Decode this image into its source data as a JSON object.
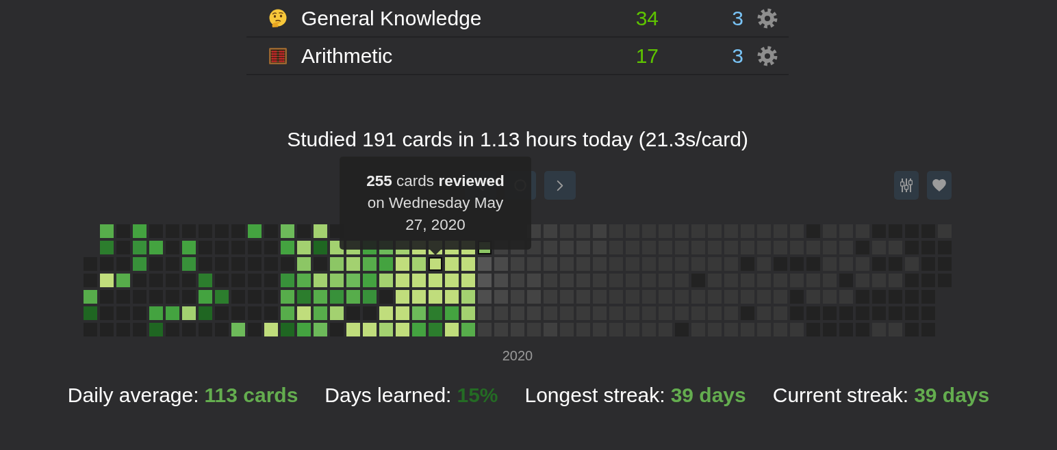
{
  "decks": [
    {
      "kind": "thinking",
      "name": "General Knowledge",
      "column_3": "34",
      "column_4": "3"
    },
    {
      "kind": "abacus",
      "name": "Arithmetic",
      "column_3": "17",
      "column_4": "3"
    }
  ],
  "summary": "Studied 191 cards in 1.13 hours today (21.3s/card)",
  "toolbar": {
    "navigation": [
      {
        "kind": "previous"
      },
      {
        "kind": "today"
      },
      {
        "kind": "next"
      }
    ],
    "tools": [
      {
        "kind": "options"
      },
      {
        "kind": "support"
      }
    ]
  },
  "heatmap": {
    "tooltip": "**255** cards **reviewed** on Wednesday May 27, 2020",
    "year_label": "2020",
    "weeks": [
      {
        "days": [
          {
            "color": "#222222"
          },
          {
            "color": "#222222"
          },
          {
            "color": "#57ad4b"
          },
          {
            "color": "#1f6622"
          },
          {
            "color": "#222222"
          }
        ]
      },
      {
        "days": [
          {
            "color": "#57ad4b"
          },
          {
            "color": "#2c7d2d"
          },
          {
            "color": "#222222"
          },
          {
            "color": "#c0dd7c"
          },
          {
            "color": "#222222"
          },
          {
            "color": "#222222"
          },
          {
            "color": "#222222"
          }
        ]
      },
      {
        "days": [
          {
            "color": "#222222"
          },
          {
            "color": "#222222"
          },
          {
            "color": "#222222"
          },
          {
            "color": "#57ad4b"
          },
          {
            "color": "#222222"
          },
          {
            "color": "#222222"
          },
          {
            "color": "#222222"
          }
        ]
      },
      {
        "days": [
          {
            "color": "#44a340"
          },
          {
            "color": "#38913a"
          },
          {
            "color": "#38913a"
          },
          {
            "color": "#222222"
          },
          {
            "color": "#222222"
          },
          {
            "color": "#222222"
          },
          {
            "color": "#222222"
          }
        ]
      },
      {
        "days": [
          {
            "color": "#222222"
          },
          {
            "color": "#44a340"
          },
          {
            "color": "#222222"
          },
          {
            "color": "#222222"
          },
          {
            "color": "#222222"
          },
          {
            "color": "#44a340"
          },
          {
            "color": "#1f6622"
          }
        ]
      },
      {
        "days": [
          {
            "color": "#222222"
          },
          {
            "color": "#222222"
          },
          {
            "color": "#222222"
          },
          {
            "color": "#222222"
          },
          {
            "color": "#222222"
          },
          {
            "color": "#44a340"
          },
          {
            "color": "#222222"
          }
        ]
      },
      {
        "days": [
          {
            "color": "#222222"
          },
          {
            "color": "#44a340"
          },
          {
            "color": "#38913a"
          },
          {
            "color": "#222222"
          },
          {
            "color": "#222222"
          },
          {
            "color": "#a3d170"
          },
          {
            "color": "#222222"
          }
        ]
      },
      {
        "days": [
          {
            "color": "#222222"
          },
          {
            "color": "#222222"
          },
          {
            "color": "#222222"
          },
          {
            "color": "#2c7d2d"
          },
          {
            "color": "#44a340"
          },
          {
            "color": "#1f6622"
          },
          {
            "color": "#222222"
          }
        ]
      },
      {
        "days": [
          {
            "color": "#222222"
          },
          {
            "color": "#222222"
          },
          {
            "color": "#222222"
          },
          {
            "color": "#222222"
          },
          {
            "color": "#2c7d2d"
          },
          {
            "color": "#222222"
          },
          {
            "color": "#222222"
          }
        ]
      },
      {
        "days": [
          {
            "color": "#222222"
          },
          {
            "color": "#222222"
          },
          {
            "color": "#222222"
          },
          {
            "color": "#222222"
          },
          {
            "color": "#222222"
          },
          {
            "color": "#222222"
          },
          {
            "color": "#6dba5a"
          }
        ]
      },
      {
        "days": [
          {
            "color": "#44a340"
          },
          {
            "color": "#222222"
          },
          {
            "color": "#222222"
          },
          {
            "color": "#222222"
          },
          {
            "color": "#222222"
          },
          {
            "color": "#222222"
          },
          {
            "color": "#222222"
          }
        ]
      },
      {
        "days": [
          {
            "color": "#222222"
          },
          {
            "color": "#222222"
          },
          {
            "color": "#222222"
          },
          {
            "color": "#222222"
          },
          {
            "color": "#222222"
          },
          {
            "color": "#222222"
          },
          {
            "color": "#c0dd7c"
          }
        ]
      },
      {
        "days": [
          {
            "color": "#6dba5a"
          },
          {
            "color": "#44a340"
          },
          {
            "color": "#222222"
          },
          {
            "color": "#38913a"
          },
          {
            "color": "#57ad4b"
          },
          {
            "color": "#57ad4b"
          },
          {
            "color": "#1f6622"
          }
        ]
      },
      {
        "days": [
          {
            "color": "#222222"
          },
          {
            "color": "#a3d170"
          },
          {
            "color": "#8cc665"
          },
          {
            "color": "#57ad4b"
          },
          {
            "color": "#2c7d2d"
          },
          {
            "color": "#c0dd7c"
          },
          {
            "color": "#44a340"
          }
        ]
      },
      {
        "days": [
          {
            "color": "#a3d170"
          },
          {
            "color": "#1f6622"
          },
          {
            "color": "#222222"
          },
          {
            "color": "#a3d170"
          },
          {
            "color": "#57ad4b"
          },
          {
            "color": "#57ad4b"
          },
          {
            "color": "#6dba5a"
          }
        ]
      },
      {
        "days": [
          {
            "color": "#222222"
          },
          {
            "color": "#a3d170"
          },
          {
            "color": "#8cc665"
          },
          {
            "color": "#8cc665"
          },
          {
            "color": "#38913a"
          },
          {
            "color": "#a3d170"
          },
          {
            "color": "#222222"
          }
        ]
      },
      {
        "days": [
          {
            "color": "#a3d170"
          },
          {
            "color": "#a3d170"
          },
          {
            "color": "#6dba5a"
          },
          {
            "color": "#57ad4b"
          },
          {
            "color": "#222222"
          },
          {
            "color": "#c0dd7c"
          }
        ]
      },
      {
        "days": [
          {
            "color": "#44a340"
          },
          {
            "color": "#57ad4b"
          },
          {
            "color": "#44a340"
          },
          {
            "color": "#38913a"
          },
          {
            "color": "#222222"
          },
          {
            "color": "#c0dd7c"
          }
        ]
      },
      {
        "days": [
          {
            "color": "#6dba5a"
          },
          {
            "color": "#44a340"
          },
          {
            "color": "#a3d170"
          },
          {
            "color": "#222222"
          },
          {
            "color": "#c0dd7c"
          },
          {
            "color": "#a3d170"
          }
        ]
      },
      {
        "days": [
          {
            "color": "#a3d170"
          },
          {
            "color": "#c0dd7c"
          },
          {
            "color": "#c0dd7c"
          },
          {
            "color": "#c0dd7c"
          },
          {
            "color": "#c0dd7c"
          },
          {
            "color": "#c0dd7c"
          }
        ]
      },
      {
        "days": [
          {
            "color": "#c0dd7c"
          },
          {
            "color": "#a3d170"
          },
          {
            "color": "#c0dd7c"
          },
          {
            "color": "#c0dd7c"
          },
          {
            "color": "#6dba5a"
          },
          {
            "color": "#44a340"
          }
        ]
      },
      {
        "days": [
          {
            "color": "#c0dd7c"
          },
          {
            "color": "#c0dd7c",
            "hovered": true
          },
          {
            "color": "#c0dd7c"
          },
          {
            "color": "#c0dd7c"
          },
          {
            "color": "#2c7d2d"
          },
          {
            "color": "#2c7d2d"
          }
        ]
      },
      {
        "days": [
          {
            "color": "#c0dd7c"
          },
          {
            "color": "#c0dd7c"
          },
          {
            "color": "#c0dd7c"
          },
          {
            "color": "#c0dd7c"
          },
          {
            "color": "#44a340"
          },
          {
            "color": "#c0dd7c"
          }
        ]
      },
      {
        "days": [
          {
            "color": "#c0dd7c"
          },
          {
            "color": "#c0dd7c"
          },
          {
            "color": "#c0dd7c"
          },
          {
            "color": "#a3d170"
          },
          {
            "color": "#a3d170"
          },
          {
            "color": "#57ad4b"
          }
        ]
      },
      {
        "days": [
          {
            "color": "#8cc665",
            "today": true
          },
          {
            "color": "#555555"
          },
          {
            "color": "#555555"
          },
          {
            "color": "#4e4e4e"
          },
          {
            "color": "#404040"
          },
          {
            "color": "#3e3e3e"
          }
        ]
      },
      {
        "days": [
          {
            "color": "#404040"
          },
          {
            "color": "#4a4a4a"
          },
          {
            "color": "#4a4a4a"
          },
          {
            "color": "#484848"
          },
          {
            "color": "#3e3e3e"
          },
          {
            "color": "#3e3e3e"
          }
        ]
      },
      {
        "days": [
          {
            "color": "#404040"
          },
          {
            "color": "#404040"
          },
          {
            "color": "#404040"
          },
          {
            "color": "#404040"
          },
          {
            "color": "#3e3e3e"
          },
          {
            "color": "#3e3e3e"
          }
        ]
      },
      {
        "days": [
          {
            "color": "#404040"
          },
          {
            "color": "#3c3c3c"
          },
          {
            "color": "#3e3e3e"
          },
          {
            "color": "#444444"
          },
          {
            "color": "#444444"
          },
          {
            "color": "#3e3e3e"
          },
          {
            "color": "#3b3b3b"
          }
        ]
      },
      {
        "days": [
          {
            "color": "#404040"
          },
          {
            "color": "#3e3e3e"
          },
          {
            "color": "#3e3e3e"
          },
          {
            "color": "#3c3c3c"
          },
          {
            "color": "#3c3c3c"
          },
          {
            "color": "#3b3b3b"
          },
          {
            "color": "#404040"
          }
        ]
      },
      {
        "days": [
          {
            "color": "#3b3b3b"
          },
          {
            "color": "#3e3e3e"
          },
          {
            "color": "#3c3c3c"
          },
          {
            "color": "#3c3c3c"
          },
          {
            "color": "#3c3c3c"
          },
          {
            "color": "#3a3a3a"
          },
          {
            "color": "#3a3a3a"
          }
        ]
      },
      {
        "days": [
          {
            "color": "#3b3b3b"
          },
          {
            "color": "#3e3e3e"
          },
          {
            "color": "#3c3c3c"
          },
          {
            "color": "#3c3c3c"
          },
          {
            "color": "#3c3c3c"
          },
          {
            "color": "#3a3a3a"
          },
          {
            "color": "#3a3a3a"
          }
        ]
      },
      {
        "days": [
          {
            "color": "#404040"
          },
          {
            "color": "#3e3e3e"
          },
          {
            "color": "#3b3b3b"
          },
          {
            "color": "#3a3a3a"
          },
          {
            "color": "#3a3a3a"
          },
          {
            "color": "#3a3a3a"
          },
          {
            "color": "#3a3a3a"
          }
        ]
      },
      {
        "days": [
          {
            "color": "#383838"
          },
          {
            "color": "#383838"
          },
          {
            "color": "#383838"
          },
          {
            "color": "#383838"
          },
          {
            "color": "#383838"
          },
          {
            "color": "#383838"
          },
          {
            "color": "#383838"
          }
        ]
      },
      {
        "days": [
          {
            "color": "#383838"
          },
          {
            "color": "#383838"
          },
          {
            "color": "#383838"
          },
          {
            "color": "#383838"
          },
          {
            "color": "#383838"
          },
          {
            "color": "#383838"
          },
          {
            "color": "#383838"
          }
        ]
      },
      {
        "days": [
          {
            "color": "#383838"
          },
          {
            "color": "#383838"
          },
          {
            "color": "#383838"
          },
          {
            "color": "#383838"
          },
          {
            "color": "#383838"
          },
          {
            "color": "#383838"
          },
          {
            "color": "#383838"
          }
        ]
      },
      {
        "days": [
          {
            "color": "#383838"
          },
          {
            "color": "#383838"
          },
          {
            "color": "#383838"
          },
          {
            "color": "#383838"
          },
          {
            "color": "#383838"
          },
          {
            "color": "#383838"
          },
          {
            "color": "#383838"
          }
        ]
      },
      {
        "days": [
          {
            "color": "#383838"
          },
          {
            "color": "#383838"
          },
          {
            "color": "#383838"
          },
          {
            "color": "#383838"
          },
          {
            "color": "#383838"
          },
          {
            "color": "#383838"
          },
          {
            "color": "#222222"
          }
        ]
      },
      {
        "days": [
          {
            "color": "#383838"
          },
          {
            "color": "#383838"
          },
          {
            "color": "#383838"
          },
          {
            "color": "#222222"
          },
          {
            "color": "#383838"
          },
          {
            "color": "#383838"
          },
          {
            "color": "#383838"
          }
        ]
      },
      {
        "days": [
          {
            "color": "#383838"
          },
          {
            "color": "#383838"
          },
          {
            "color": "#383838"
          },
          {
            "color": "#383838"
          },
          {
            "color": "#383838"
          },
          {
            "color": "#383838"
          },
          {
            "color": "#383838"
          }
        ]
      },
      {
        "days": [
          {
            "color": "#383838"
          },
          {
            "color": "#383838"
          },
          {
            "color": "#383838"
          },
          {
            "color": "#383838"
          },
          {
            "color": "#383838"
          },
          {
            "color": "#383838"
          },
          {
            "color": "#383838"
          }
        ]
      },
      {
        "days": [
          {
            "color": "#383838"
          },
          {
            "color": "#383838"
          },
          {
            "color": "#222222"
          },
          {
            "color": "#383838"
          },
          {
            "color": "#383838"
          },
          {
            "color": "#222222"
          },
          {
            "color": "#383838"
          }
        ]
      },
      {
        "days": [
          {
            "color": "#383838"
          },
          {
            "color": "#383838"
          },
          {
            "color": "#383838"
          },
          {
            "color": "#383838"
          },
          {
            "color": "#383838"
          },
          {
            "color": "#383838"
          },
          {
            "color": "#383838"
          }
        ]
      },
      {
        "days": [
          {
            "color": "#383838"
          },
          {
            "color": "#383838"
          },
          {
            "color": "#222222"
          },
          {
            "color": "#383838"
          },
          {
            "color": "#383838"
          },
          {
            "color": "#383838"
          },
          {
            "color": "#383838"
          }
        ]
      },
      {
        "days": [
          {
            "color": "#383838"
          },
          {
            "color": "#383838"
          },
          {
            "color": "#222222"
          },
          {
            "color": "#383838"
          },
          {
            "color": "#222222"
          },
          {
            "color": "#222222"
          },
          {
            "color": "#383838"
          }
        ]
      },
      {
        "days": [
          {
            "color": "#222222"
          },
          {
            "color": "#383838"
          },
          {
            "color": "#222222"
          },
          {
            "color": "#383838"
          },
          {
            "color": "#383838"
          },
          {
            "color": "#222222"
          },
          {
            "color": "#222222"
          }
        ]
      },
      {
        "days": [
          {
            "color": "#383838"
          },
          {
            "color": "#383838"
          },
          {
            "color": "#383838"
          },
          {
            "color": "#383838"
          },
          {
            "color": "#383838"
          },
          {
            "color": "#222222"
          },
          {
            "color": "#222222"
          }
        ]
      },
      {
        "days": [
          {
            "color": "#383838"
          },
          {
            "color": "#383838"
          },
          {
            "color": "#383838"
          },
          {
            "color": "#222222"
          },
          {
            "color": "#383838"
          },
          {
            "color": "#222222"
          },
          {
            "color": "#222222"
          }
        ]
      },
      {
        "days": [
          {
            "color": "#383838"
          },
          {
            "color": "#222222"
          },
          {
            "color": "#383838"
          },
          {
            "color": "#383838"
          },
          {
            "color": "#222222"
          },
          {
            "color": "#222222"
          },
          {
            "color": "#222222"
          }
        ]
      },
      {
        "days": [
          {
            "color": "#222222"
          },
          {
            "color": "#383838"
          },
          {
            "color": "#222222"
          },
          {
            "color": "#383838"
          },
          {
            "color": "#222222"
          },
          {
            "color": "#222222"
          },
          {
            "color": "#383838"
          }
        ]
      },
      {
        "days": [
          {
            "color": "#222222"
          },
          {
            "color": "#383838"
          },
          {
            "color": "#222222"
          },
          {
            "color": "#383838"
          },
          {
            "color": "#222222"
          },
          {
            "color": "#222222"
          },
          {
            "color": "#383838"
          }
        ]
      },
      {
        "days": [
          {
            "color": "#222222"
          },
          {
            "color": "#222222"
          },
          {
            "color": "#383838"
          },
          {
            "color": "#222222"
          },
          {
            "color": "#222222"
          },
          {
            "color": "#222222"
          },
          {
            "color": "#222222"
          }
        ]
      },
      {
        "days": [
          {
            "color": "#222222"
          },
          {
            "color": "#222222"
          },
          {
            "color": "#222222"
          },
          {
            "color": "#222222"
          },
          {
            "color": "#222222"
          },
          {
            "color": "#222222"
          },
          {
            "color": "#222222"
          }
        ]
      },
      {
        "days": [
          {
            "color": "#383838"
          },
          {
            "color": "#222222"
          },
          {
            "color": "#222222"
          },
          {
            "color": "#222222"
          }
        ]
      }
    ]
  },
  "stats": [
    {
      "label": "Daily average:",
      "value": "113 cards",
      "color": "#64ad4f"
    },
    {
      "label": "Days learned:",
      "value": "15%",
      "color": "#246b24"
    },
    {
      "label": "Longest streak:",
      "value": "39 days",
      "color": "#64ad4f"
    },
    {
      "label": "Current streak:",
      "value": "39 days",
      "color": "#64ad4f"
    }
  ]
}
